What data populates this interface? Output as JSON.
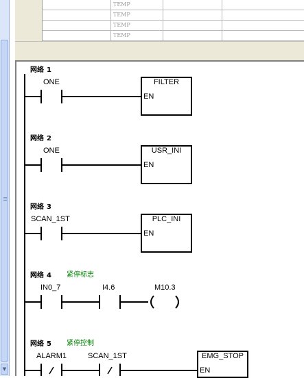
{
  "var_table": {
    "rows": [
      {
        "type": "TEMP"
      },
      {
        "type": "TEMP"
      },
      {
        "type": "TEMP"
      },
      {
        "type": "TEMP"
      }
    ]
  },
  "ladder": {
    "network_label": "网络",
    "networks": [
      {
        "number": "1",
        "comment": "",
        "contacts": [
          {
            "name": "ONE",
            "negated": false
          }
        ],
        "box": {
          "name": "FILTER",
          "input": "EN"
        }
      },
      {
        "number": "2",
        "comment": "",
        "contacts": [
          {
            "name": "ONE",
            "negated": false
          }
        ],
        "box": {
          "name": "USR_INI",
          "input": "EN"
        }
      },
      {
        "number": "3",
        "comment": "",
        "contacts": [
          {
            "name": "SCAN_1ST",
            "negated": false
          }
        ],
        "box": {
          "name": "PLC_INI",
          "input": "EN"
        }
      },
      {
        "number": "4",
        "comment": "紧停标志",
        "contacts": [
          {
            "name": "IN0_7",
            "negated": false
          },
          {
            "name": "I4.6",
            "negated": false
          }
        ],
        "coil": {
          "name": "M10.3"
        }
      },
      {
        "number": "5",
        "comment": "紧停控制",
        "contacts": [
          {
            "name": "ALARM1",
            "negated": true
          },
          {
            "name": "SCAN_1ST",
            "negated": true
          }
        ],
        "box": {
          "name": "EMG_STOP",
          "input": "EN"
        }
      }
    ]
  }
}
